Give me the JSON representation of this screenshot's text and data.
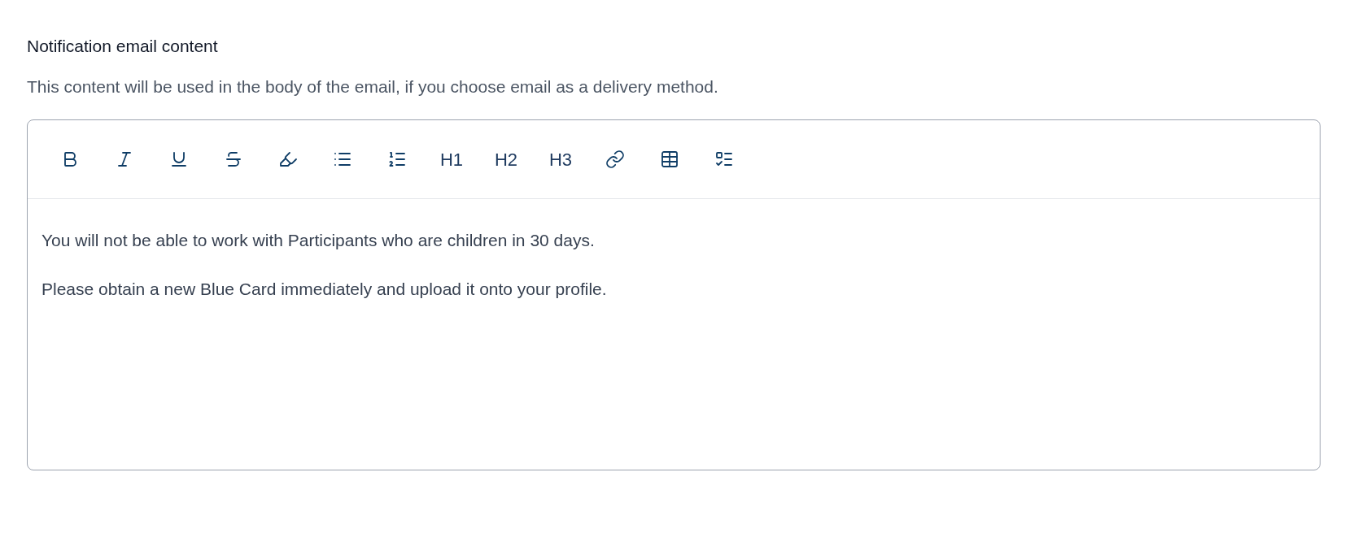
{
  "field": {
    "label": "Notification email content",
    "help": "This content will be used in the body of the email, if you choose email as a delivery method."
  },
  "toolbar": [
    {
      "kind": "bold"
    },
    {
      "kind": "italic"
    },
    {
      "kind": "underline"
    },
    {
      "kind": "strike"
    },
    {
      "kind": "highlight"
    },
    {
      "kind": "bullets"
    },
    {
      "kind": "numbers"
    },
    {
      "kind": "heading",
      "label": "H1"
    },
    {
      "kind": "heading",
      "label": "H2"
    },
    {
      "kind": "heading",
      "label": "H3"
    },
    {
      "kind": "link"
    },
    {
      "kind": "table"
    },
    {
      "kind": "tasks"
    }
  ],
  "content": [
    "You will not be able to work with Participants who are children in 30 days.",
    "Please obtain a new Blue Card immediately and upload it onto your profile."
  ]
}
